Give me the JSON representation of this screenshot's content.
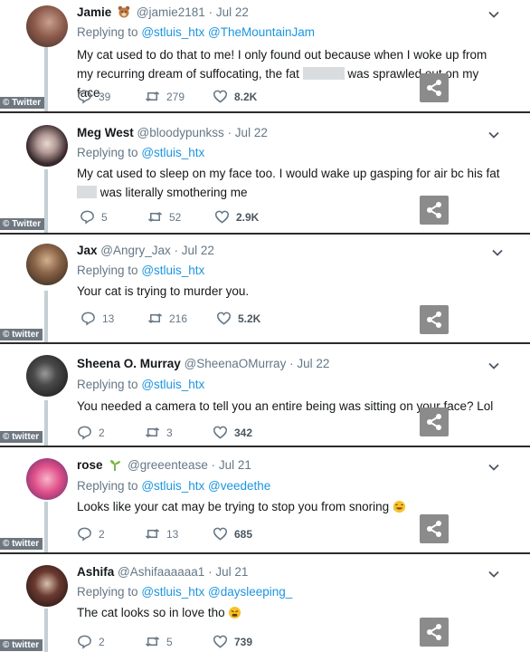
{
  "tweets": [
    {
      "name": "Jamie",
      "handle": "@jamie2181",
      "date": "· Jul 22",
      "emoji": "bear",
      "replying_prefix": "Replying to",
      "replying_to": "@stluis_htx @TheMountainJam",
      "text_a": "My cat used to do that to me!  I only found out because when I woke up from my recurring dream of suffocating, the fat ",
      "text_b": " was sprawled out on my face.",
      "replies": "39",
      "retweets": "279",
      "likes": "8.2K",
      "watermark": "© Twitter"
    },
    {
      "name": "Meg West",
      "handle": "@bloodypunkss",
      "date": "· Jul 22",
      "replying_prefix": "Replying to",
      "replying_to": "@stluis_htx",
      "text_a": "My cat used to sleep on my face too. I would wake up gasping for air bc his fat ",
      "text_b": " was literally smothering me",
      "replies": "5",
      "retweets": "52",
      "likes": "2.9K",
      "watermark": "© Twitter"
    },
    {
      "name": "Jax",
      "handle": "@Angry_Jax",
      "date": "· Jul 22",
      "replying_prefix": "Replying to",
      "replying_to": "@stluis_htx",
      "text_a": "Your cat is trying to murder you.",
      "text_b": "",
      "replies": "13",
      "retweets": "216",
      "likes": "5.2K",
      "watermark": "© twitter"
    },
    {
      "name": "Sheena O. Murray",
      "handle": "@SheenaOMurray",
      "date": "· Jul 22",
      "replying_prefix": "Replying to",
      "replying_to": "@stluis_htx",
      "text_a": "You needed a camera to tell you an entire being was sitting on your face? Lol",
      "text_b": "",
      "replies": "2",
      "retweets": "3",
      "likes": "342",
      "watermark": "© twitter"
    },
    {
      "name": "rose",
      "handle": "@greeentease",
      "date": "· Jul 21",
      "emoji": "seedling",
      "replying_prefix": "Replying to",
      "replying_to": "@stluis_htx @veedethe",
      "text_a": "Looks like your cat may be trying to stop you from snoring ",
      "text_b": "",
      "text_emoji": "rofl",
      "replies": "2",
      "retweets": "13",
      "likes": "685",
      "watermark": "© twitter"
    },
    {
      "name": "Ashifa",
      "handle": "@Ashifaaaaaa1",
      "date": "· Jul 21",
      "replying_prefix": "Replying to",
      "replying_to": "@stluis_htx @daysleeping_",
      "text_a": "The cat looks so in love tho ",
      "text_b": "",
      "text_emoji": "weary",
      "replies": "2",
      "retweets": "5",
      "likes": "739",
      "watermark": "© twitter"
    }
  ],
  "colors": {
    "link": "#1b95e0",
    "muted": "#657786",
    "share_button": "#8b8b8b"
  }
}
